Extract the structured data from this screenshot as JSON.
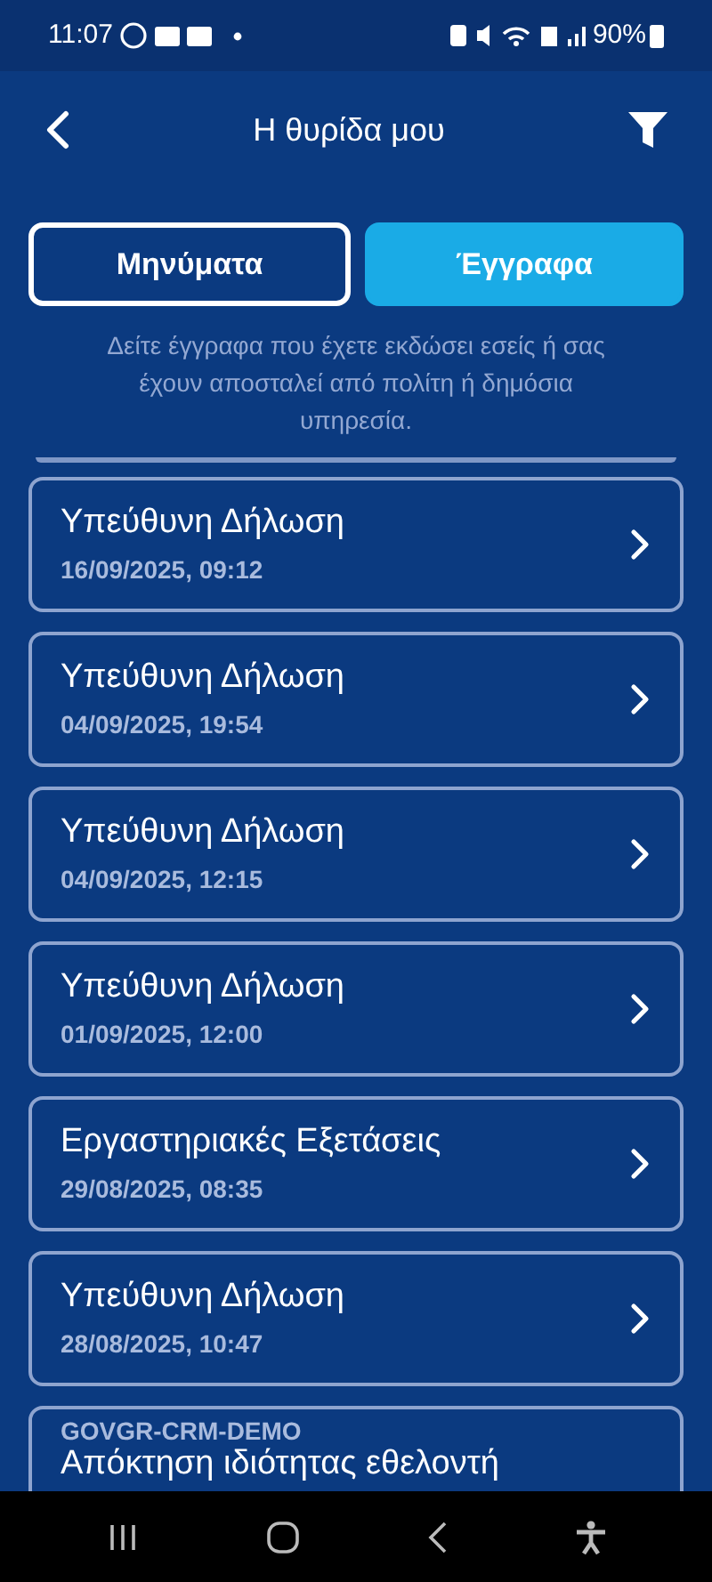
{
  "status_bar": {
    "time": "11:07",
    "battery": "90%"
  },
  "header": {
    "title": "Η θυρίδα μου"
  },
  "tabs": [
    {
      "label": "Μηνύματα",
      "selected": false
    },
    {
      "label": "Έγγραφα",
      "selected": true
    }
  ],
  "description": "Δείτε έγγραφα που έχετε εκδώσει εσείς ή σας έχουν αποσταλεί από πολίτη ή δημόσια υπηρεσία.",
  "documents": [
    {
      "kind": "dated",
      "title": "Υπεύθυνη Δήλωση",
      "date": "16/09/2025, 09:12"
    },
    {
      "kind": "dated",
      "title": "Υπεύθυνη Δήλωση",
      "date": "04/09/2025, 19:54"
    },
    {
      "kind": "dated",
      "title": "Υπεύθυνη Δήλωση",
      "date": "04/09/2025, 12:15"
    },
    {
      "kind": "dated",
      "title": "Υπεύθυνη Δήλωση",
      "date": "01/09/2025, 12:00"
    },
    {
      "kind": "dated",
      "title": "Εργαστηριακές Εξετάσεις",
      "date": "29/08/2025, 08:35"
    },
    {
      "kind": "dated",
      "title": "Υπεύθυνη Δήλωση",
      "date": "28/08/2025, 10:47"
    },
    {
      "kind": "sender",
      "sender": "GOVGR-CRM-DEMO",
      "title": "Απόκτηση ιδιότητας εθελοντή"
    }
  ]
}
